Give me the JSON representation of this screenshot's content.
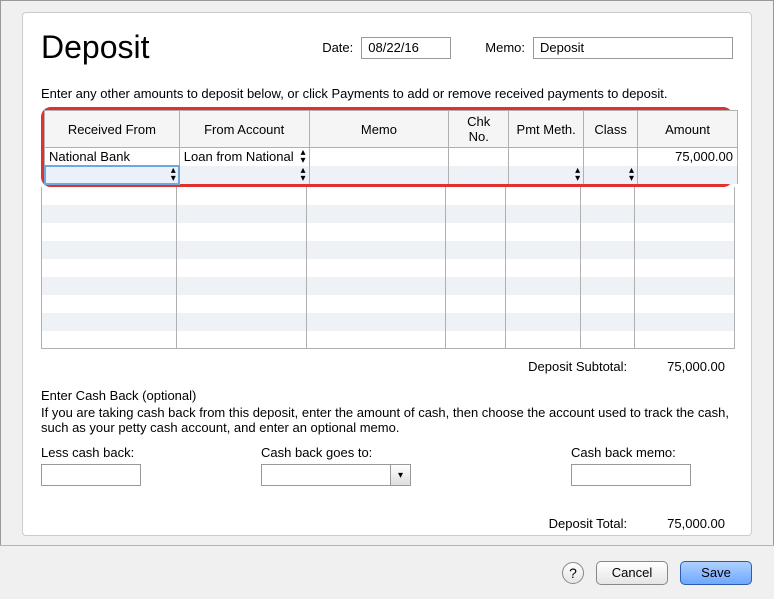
{
  "header": {
    "title": "Deposit",
    "date_label": "Date:",
    "date_value": "08/22/16",
    "memo_label": "Memo:",
    "memo_value": "Deposit"
  },
  "instruction": "Enter any other amounts to deposit below, or click Payments to add or remove received payments to deposit.",
  "columns": {
    "received_from": "Received From",
    "from_account": "From Account",
    "memo": "Memo",
    "chk_no": "Chk No.",
    "pmt_meth": "Pmt Meth.",
    "class": "Class",
    "amount": "Amount"
  },
  "rows": [
    {
      "received_from": "National Bank",
      "from_account": "Loan from National",
      "memo": "",
      "chk_no": "",
      "pmt_meth": "",
      "class": "",
      "amount": "75,000.00"
    }
  ],
  "subtotal": {
    "label": "Deposit Subtotal:",
    "value": "75,000.00"
  },
  "cashback": {
    "title": "Enter Cash Back (optional)",
    "desc": "If you are taking cash back from this deposit, enter the amount of cash, then choose the account used to track the cash, such as your petty cash account, and enter an optional memo.",
    "less_label": "Less cash back:",
    "goes_to_label": "Cash back goes to:",
    "memo_label": "Cash back memo:"
  },
  "total": {
    "label": "Deposit Total:",
    "value": "75,000.00"
  },
  "footer": {
    "help": "?",
    "cancel": "Cancel",
    "save": "Save"
  }
}
